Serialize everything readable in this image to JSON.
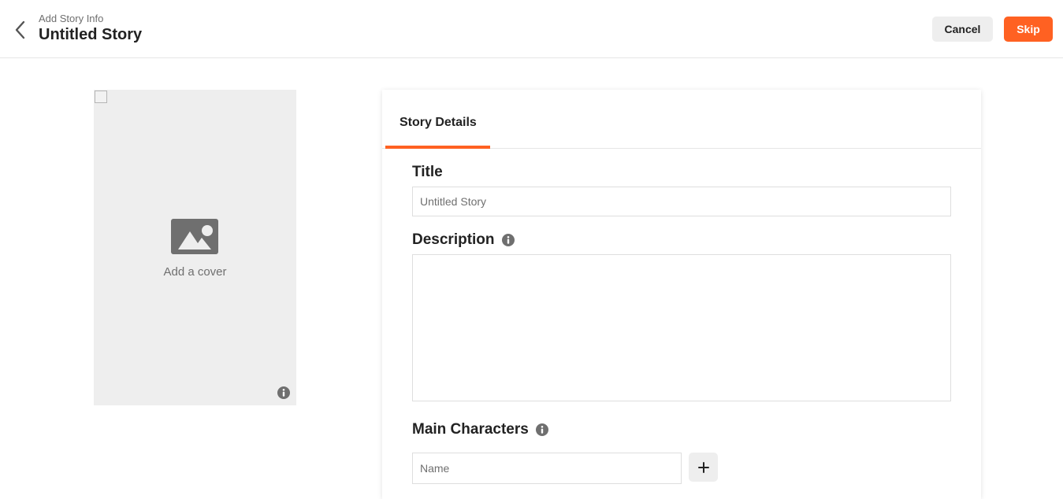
{
  "header": {
    "breadcrumb": "Add Story Info",
    "title": "Untitled Story",
    "cancel_label": "Cancel",
    "skip_label": "Skip"
  },
  "cover": {
    "label": "Add a cover",
    "icon": "image-icon"
  },
  "tabs": [
    {
      "label": "Story Details",
      "active": true
    }
  ],
  "form": {
    "title_label": "Title",
    "title_placeholder": "Untitled Story",
    "title_value": "",
    "description_label": "Description",
    "description_value": "",
    "characters_label": "Main Characters",
    "name_placeholder": "Name",
    "add_icon": "plus-icon"
  },
  "colors": {
    "accent": "#ff6122",
    "cover_bg": "#eeeeee",
    "muted_text": "#6f6f6f"
  }
}
